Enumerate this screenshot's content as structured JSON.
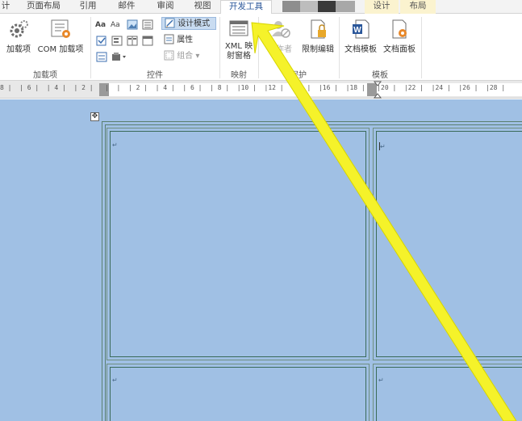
{
  "ribbon_tabs": [
    {
      "label": "计",
      "active": false
    },
    {
      "label": "页面布局",
      "active": false
    },
    {
      "label": "引用",
      "active": false
    },
    {
      "label": "邮件",
      "active": false
    },
    {
      "label": "审阅",
      "active": false
    },
    {
      "label": "视图",
      "active": false
    },
    {
      "label": "开发工具",
      "active": true
    },
    {
      "label": "设计",
      "context": true
    },
    {
      "label": "布局",
      "context": true
    }
  ],
  "groups": {
    "addins": {
      "label": "加载项",
      "buttons": [
        {
          "label": "加载项",
          "icon": "gear-icon"
        },
        {
          "label": "COM 加载项",
          "icon": "com-addin-icon"
        }
      ]
    },
    "controls": {
      "label": "控件",
      "design_mode": "设计模式",
      "properties": "属性",
      "group": "组合",
      "text_aa1": "Aa",
      "text_aa2": "Aa"
    },
    "mapping": {
      "label": "映射",
      "xml_line1": "XML 映",
      "xml_line2": "射窗格"
    },
    "protect": {
      "label": "保护",
      "block_authors": "止作者",
      "restrict_editing": "限制编辑"
    },
    "templates": {
      "label": "模板",
      "doc_template": "文档模板",
      "doc_panel": "文档面板"
    }
  },
  "ruler_text": "8 |  | 6 |  | 4 |  | 2 |   |  |  | 2 |  | 4 |  | 6 |  | 8 |  |10 |  |12 |  |14 |  |16 |  |18 |   |20 |  |22 |  |24 |  |26 |  |28 |",
  "move_handle": "✥",
  "para_mark": "↵",
  "colors": {
    "accent": "#2b579a",
    "page_bg": "#a0c0e4",
    "table_border": "#3b6b5a",
    "context_tab": "#fbf3cf",
    "selected": "#c9dcf1"
  }
}
